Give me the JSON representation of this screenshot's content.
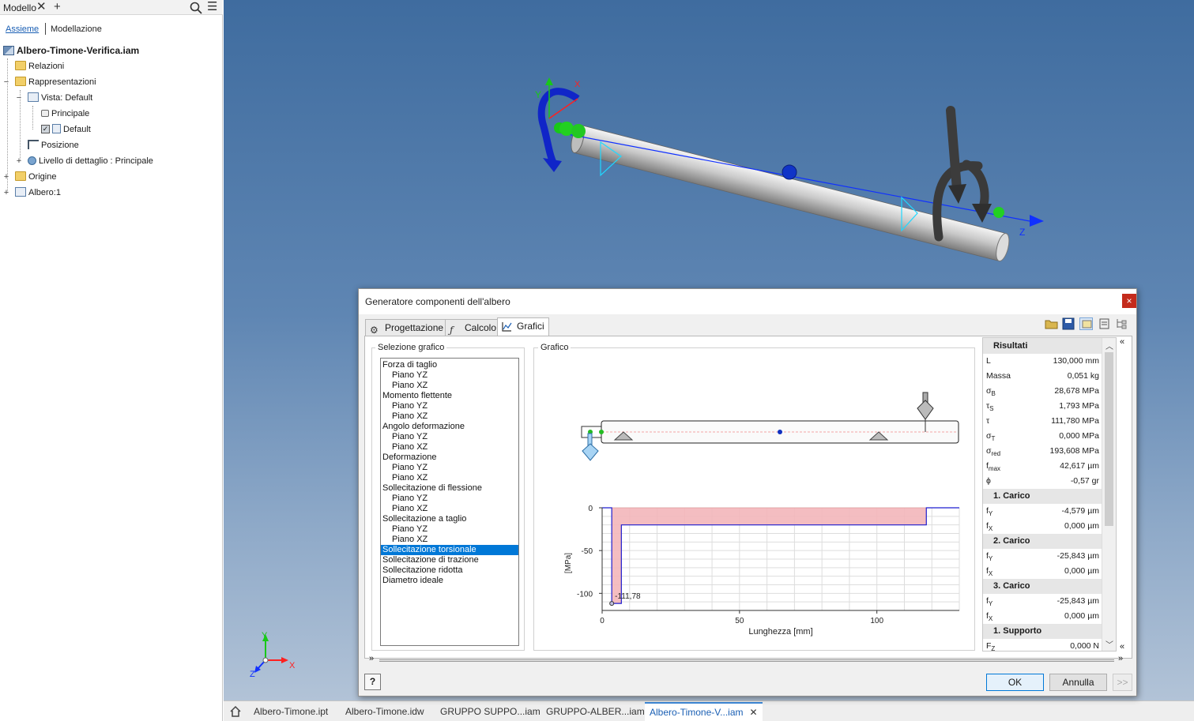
{
  "browser": {
    "title": "Modello",
    "tabs": {
      "assieme": "Assieme",
      "modellazione": "Modellazione"
    },
    "tree": [
      {
        "label": "Albero-Timone-Verifica.iam",
        "icon": "assembly-icon"
      },
      {
        "label": "Relazioni",
        "icon": "folder-icon"
      },
      {
        "label": "Rappresentazioni",
        "icon": "folder-icon"
      },
      {
        "label": "Vista: Default",
        "icon": "view-rep-icon"
      },
      {
        "label": "Principale",
        "icon": "lock-icon"
      },
      {
        "label": "Default",
        "icon": "checked-view-icon"
      },
      {
        "label": "Posizione",
        "icon": "position-rep-icon"
      },
      {
        "label": "Livello di dettaglio : Principale",
        "icon": "lod-icon"
      },
      {
        "label": "Origine",
        "icon": "folder-icon"
      },
      {
        "label": "Albero:1",
        "icon": "part-icon"
      }
    ]
  },
  "viewport": {
    "axis_labels": {
      "x": "X",
      "y": "Y",
      "z": "Z"
    },
    "triad_labels": {
      "x": "X",
      "y": "Y",
      "z": "Z"
    }
  },
  "doc_tabs": [
    "Albero-Timone.ipt",
    "Albero-Timone.idw",
    "GRUPPO SUPPO...iam",
    "GRUPPO-ALBER...iam",
    "Albero-Timone-V...iam"
  ],
  "dialog": {
    "title": "Generatore componenti dell'albero",
    "close_label": "×",
    "tabs": [
      "Progettazione",
      "Calcolo",
      "Grafici"
    ],
    "selection_group_label": "Selezione grafico",
    "graph_group_label": "Grafico",
    "graph_list": [
      {
        "label": "Forza di taglio",
        "sub": false
      },
      {
        "label": "Piano YZ",
        "sub": true
      },
      {
        "label": "Piano XZ",
        "sub": true
      },
      {
        "label": "Momento flettente",
        "sub": false
      },
      {
        "label": "Piano YZ",
        "sub": true
      },
      {
        "label": "Piano XZ",
        "sub": true
      },
      {
        "label": "Angolo deformazione",
        "sub": false
      },
      {
        "label": "Piano YZ",
        "sub": true
      },
      {
        "label": "Piano XZ",
        "sub": true
      },
      {
        "label": "Deformazione",
        "sub": false
      },
      {
        "label": "Piano YZ",
        "sub": true
      },
      {
        "label": "Piano XZ",
        "sub": true
      },
      {
        "label": "Sollecitazione di flessione",
        "sub": false
      },
      {
        "label": "Piano YZ",
        "sub": true
      },
      {
        "label": "Piano XZ",
        "sub": true
      },
      {
        "label": "Sollecitazione a taglio",
        "sub": false
      },
      {
        "label": "Piano YZ",
        "sub": true
      },
      {
        "label": "Piano XZ",
        "sub": true
      },
      {
        "label": "Sollecitazione torsionale",
        "sub": false,
        "selected": true
      },
      {
        "label": "Sollecitazione di trazione",
        "sub": false
      },
      {
        "label": "Sollecitazione ridotta",
        "sub": false
      },
      {
        "label": "Diametro ideale",
        "sub": false
      }
    ],
    "results": {
      "header": "Risultati",
      "rows": [
        {
          "type": "row",
          "label": "L",
          "value": "130,000 mm"
        },
        {
          "type": "row",
          "label": "Massa",
          "value": "0,051 kg"
        },
        {
          "type": "row",
          "label": "σ",
          "sub": "B",
          "value": "28,678 MPa"
        },
        {
          "type": "row",
          "label": "τ",
          "sub": "S",
          "value": "1,793 MPa"
        },
        {
          "type": "row",
          "label": "τ",
          "value": "111,780 MPa"
        },
        {
          "type": "row",
          "label": "σ",
          "sub": "T",
          "value": "0,000 MPa"
        },
        {
          "type": "row",
          "label": "σ",
          "sub": "red",
          "value": "193,608 MPa"
        },
        {
          "type": "row",
          "label": "f",
          "sub": "max",
          "value": "42,617 µm"
        },
        {
          "type": "row",
          "label": "ϕ",
          "value": "-0,57 gr"
        },
        {
          "type": "section",
          "label": "1. Carico"
        },
        {
          "type": "row",
          "label": "f",
          "sub": "Y",
          "value": "-4,579 µm"
        },
        {
          "type": "row",
          "label": "f",
          "sub": "X",
          "value": "0,000 µm"
        },
        {
          "type": "section",
          "label": "2. Carico"
        },
        {
          "type": "row",
          "label": "f",
          "sub": "Y",
          "value": "-25,843 µm"
        },
        {
          "type": "row",
          "label": "f",
          "sub": "X",
          "value": "0,000 µm"
        },
        {
          "type": "section",
          "label": "3. Carico"
        },
        {
          "type": "row",
          "label": "f",
          "sub": "Y",
          "value": "-25,843 µm"
        },
        {
          "type": "row",
          "label": "f",
          "sub": "X",
          "value": "0,000 µm"
        },
        {
          "type": "section",
          "label": "1. Supporto"
        },
        {
          "type": "row",
          "label": "F",
          "sub": "Z",
          "value": "0,000 N"
        }
      ]
    },
    "buttons": {
      "help": "?",
      "ok": "OK",
      "cancel": "Annulla",
      "more": ">>"
    }
  },
  "chart_data": {
    "type": "area",
    "xlabel": "Lunghezza [mm]",
    "ylabel": "[MPa]",
    "xlim": [
      0,
      130
    ],
    "ylim": [
      -120,
      0
    ],
    "xticks": [
      0,
      50,
      100
    ],
    "yticks": [
      0,
      -50,
      -100
    ],
    "grid": true,
    "annotation": "-111,78",
    "x": [
      0,
      3.5,
      3.5,
      7,
      7,
      118,
      118,
      130
    ],
    "y": [
      0,
      0,
      -111.78,
      -111.78,
      -20,
      -20,
      0,
      0
    ],
    "colors": {
      "fill": "#f3b6ba",
      "line": "#1f1fd0"
    }
  }
}
